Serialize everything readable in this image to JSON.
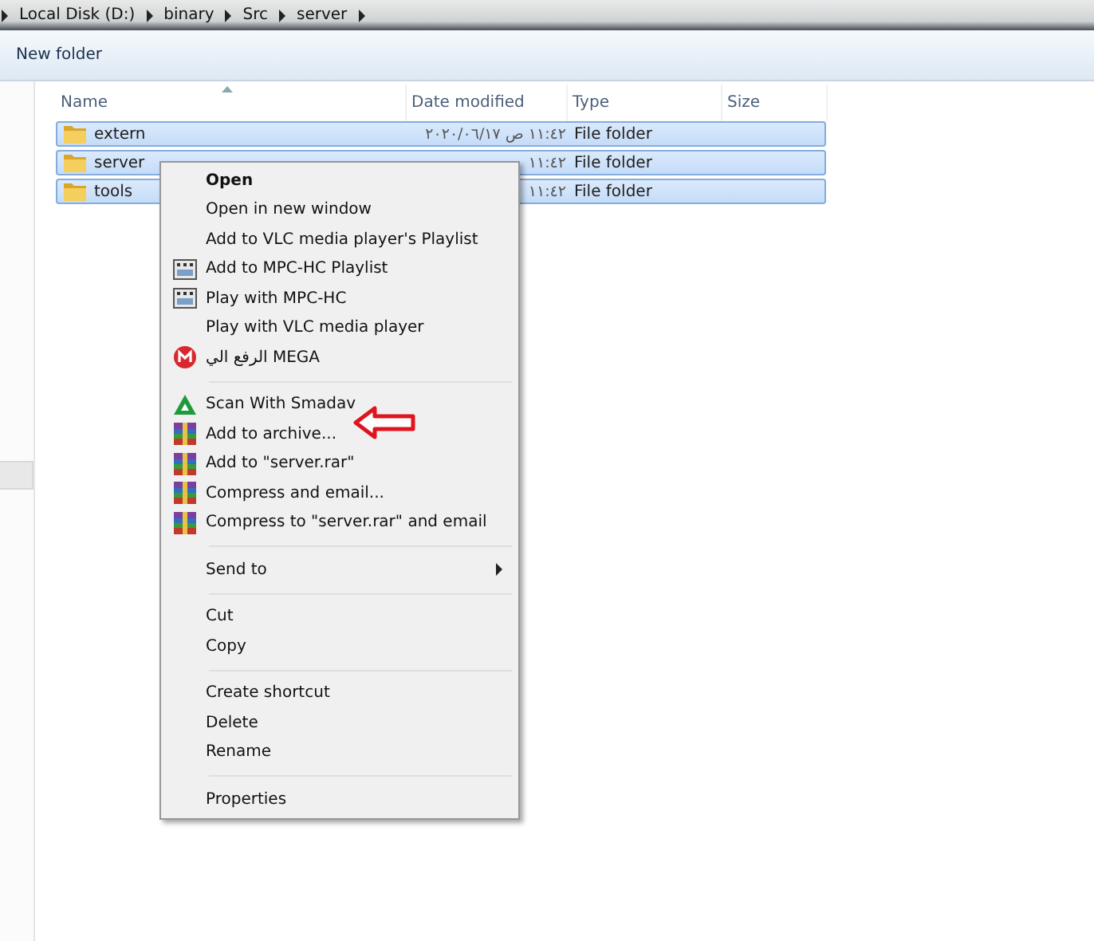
{
  "breadcrumb": [
    "Local Disk (D:)",
    "binary",
    "Src",
    "server"
  ],
  "toolbar": {
    "buttons": [
      "New folder"
    ]
  },
  "table": {
    "columns": [
      "Name",
      "Date modified",
      "Type",
      "Size"
    ],
    "rows": [
      {
        "name": "extern",
        "date": "٢٠٢٠/٠٦/١٧ ص ١١:٤٢",
        "type": "File folder",
        "selected": true
      },
      {
        "name": "server",
        "date": "١١:٤٢",
        "type": "File folder",
        "selected": true
      },
      {
        "name": "tools",
        "date": "١١:٤٢",
        "type": "File folder",
        "selected": true
      }
    ]
  },
  "context_menu": {
    "items": [
      {
        "kind": "item",
        "label": "Open",
        "default": true
      },
      {
        "kind": "item",
        "label": "Open in new window",
        "default": false
      },
      {
        "kind": "item",
        "label": "Add to VLC media player's Playlist"
      },
      {
        "kind": "film",
        "label": "Add to MPC-HC Playlist"
      },
      {
        "kind": "film",
        "label": "Play with MPC-HC"
      },
      {
        "kind": "item",
        "label": "Play with VLC media player"
      },
      {
        "kind": "mega",
        "label": "الرفع الي MEGA"
      },
      {
        "kind": "separator"
      },
      {
        "kind": "smadav",
        "label": "Scan With Smadav"
      },
      {
        "kind": "archive",
        "label": "Add to archive..."
      },
      {
        "kind": "archive",
        "label": "Add to \"server.rar\""
      },
      {
        "kind": "archive",
        "label": "Compress and email..."
      },
      {
        "kind": "archive",
        "label": "Compress to \"server.rar\" and email"
      },
      {
        "kind": "separator"
      },
      {
        "kind": "item",
        "label": "Send to",
        "submenu": true
      },
      {
        "kind": "separator"
      },
      {
        "kind": "item",
        "label": "Cut"
      },
      {
        "kind": "item",
        "label": "Copy"
      },
      {
        "kind": "separator"
      },
      {
        "kind": "item",
        "label": "Create shortcut"
      },
      {
        "kind": "item",
        "label": "Delete"
      },
      {
        "kind": "item",
        "label": "Rename"
      },
      {
        "kind": "separator"
      },
      {
        "kind": "item",
        "label": "Properties"
      }
    ]
  }
}
